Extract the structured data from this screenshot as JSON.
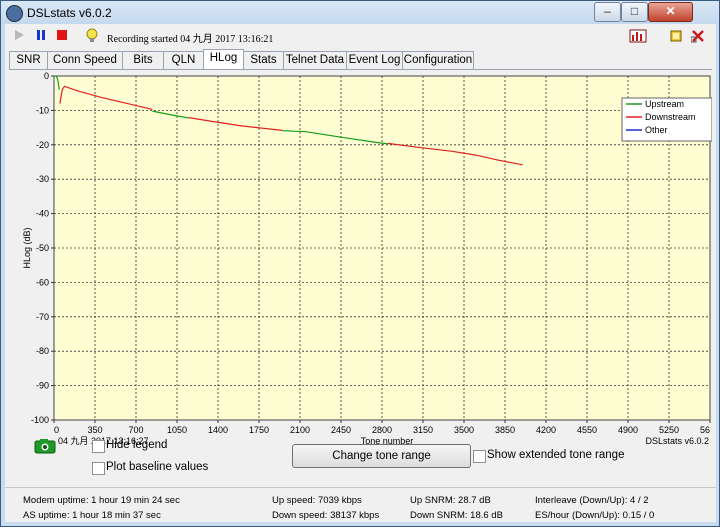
{
  "window": {
    "title": "DSLstats v6.0.2"
  },
  "titlebar_buttons": {
    "minimize": "–",
    "maximize": "□",
    "close": "✕"
  },
  "toolbar": {
    "recording_text": "Recording started 04 九月 2017 13:16:21"
  },
  "tabs": [
    "SNR",
    "Conn Speed",
    "Bits",
    "QLN",
    "HLog",
    "Stats",
    "Telnet Data",
    "Event Log",
    "Configuration"
  ],
  "active_tab": "HLog",
  "chart_data": {
    "type": "line",
    "ylabel": "HLog (dB)",
    "xlabel": "Tone number",
    "timestamp_label": "04 九月 2017 13:16:27",
    "watermark": "DSLstats v6.0.2",
    "y_ticks": [
      "0",
      "-10",
      "-20",
      "-30",
      "-40",
      "-50",
      "-60",
      "-70",
      "-80",
      "-90",
      "-100"
    ],
    "x_ticks": [
      "0",
      "350",
      "700",
      "1050",
      "1400",
      "1750",
      "2100",
      "2450",
      "2800",
      "3150",
      "3500",
      "3850",
      "4200",
      "4550",
      "4900",
      "5250",
      "56"
    ],
    "xlim": [
      0,
      5600
    ],
    "ylim": [
      -100,
      0
    ],
    "legend_position": "top-right",
    "series": [
      {
        "name": "Upstream",
        "color": "#1a9b1a",
        "segments": [
          [
            [
              0,
              0
            ],
            [
              20,
              0
            ],
            [
              32,
              -1
            ],
            [
              45,
              -4
            ]
          ],
          [
            [
              840,
              -10.2
            ],
            [
              1000,
              -11.3
            ],
            [
              1150,
              -12.2
            ]
          ],
          [
            [
              1950,
              -15.9
            ],
            [
              2150,
              -16.2
            ],
            [
              2450,
              -17.8
            ],
            [
              2750,
              -19.3
            ],
            [
              2850,
              -19.7
            ]
          ]
        ]
      },
      {
        "name": "Downstream",
        "color": "#e02020",
        "segments": [
          [
            [
              50,
              -8
            ],
            [
              70,
              -4
            ],
            [
              90,
              -3
            ],
            [
              200,
              -4.3
            ],
            [
              400,
              -6.2
            ],
            [
              600,
              -7.8
            ],
            [
              840,
              -9.7
            ]
          ],
          [
            [
              1150,
              -12.1
            ],
            [
              1350,
              -13.2
            ],
            [
              1600,
              -14.5
            ],
            [
              1950,
              -15.8
            ]
          ],
          [
            [
              2850,
              -19.6
            ],
            [
              3100,
              -20.7
            ],
            [
              3400,
              -21.9
            ],
            [
              3600,
              -23
            ],
            [
              3800,
              -24.5
            ],
            [
              3950,
              -25.5
            ],
            [
              4000,
              -25.8
            ]
          ]
        ]
      },
      {
        "name": "Other",
        "color": "#1f2bd6",
        "segments": []
      }
    ]
  },
  "controls": {
    "hide_legend": "Hide legend",
    "plot_baseline": "Plot baseline values",
    "change_tone_range": "Change tone range",
    "show_extended": "Show extended tone range"
  },
  "status": {
    "modem_uptime": "Modem uptime:  1 hour 19 min 24 sec",
    "as_uptime": "AS uptime:  1 hour 18 min 37 sec",
    "up_speed": "Up speed: 7039 kbps",
    "down_speed": "Down speed: 38137 kbps",
    "up_snrm": "Up SNRM: 28.7 dB",
    "down_snrm": "Down SNRM: 18.6 dB",
    "interleave": "Interleave (Down/Up): 4 / 2",
    "es_hour": "ES/hour (Down/Up): 0.15 / 0"
  }
}
